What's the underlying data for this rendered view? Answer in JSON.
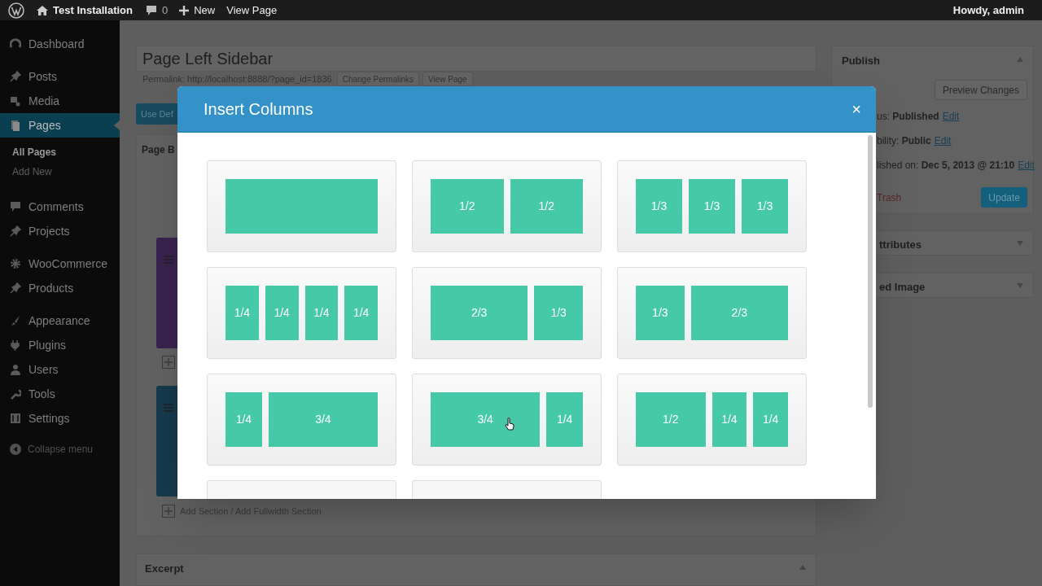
{
  "admin_bar": {
    "site_name": "Test Installation",
    "comments_count": "0",
    "new_label": "New",
    "view_label": "View Page",
    "greeting": "Howdy, admin"
  },
  "sidebar": {
    "groups": [
      {
        "items": [
          {
            "label": "Dashboard",
            "kind": "dashboard",
            "selected": false
          }
        ]
      },
      {
        "items": [
          {
            "label": "Posts",
            "kind": "pin",
            "selected": false
          },
          {
            "label": "Media",
            "kind": "media",
            "selected": false
          },
          {
            "label": "Pages",
            "kind": "pages",
            "selected": true,
            "children": [
              {
                "label": "All Pages",
                "selected": true
              },
              {
                "label": "Add New",
                "selected": false
              }
            ]
          }
        ]
      },
      {
        "items": [
          {
            "label": "Comments",
            "kind": "comment",
            "selected": false
          },
          {
            "label": "Projects",
            "kind": "pin",
            "selected": false
          }
        ]
      },
      {
        "items": [
          {
            "label": "WooCommerce",
            "kind": "gear",
            "selected": false
          },
          {
            "label": "Products",
            "kind": "pin",
            "selected": false
          }
        ]
      },
      {
        "items": [
          {
            "label": "Appearance",
            "kind": "brush",
            "selected": false
          },
          {
            "label": "Plugins",
            "kind": "plug",
            "selected": false
          },
          {
            "label": "Users",
            "kind": "user",
            "selected": false
          },
          {
            "label": "Tools",
            "kind": "wrench",
            "selected": false
          },
          {
            "label": "Settings",
            "kind": "sliders",
            "selected": false
          }
        ]
      }
    ],
    "collapse_label": "Collapse menu"
  },
  "editor": {
    "title": "Page Left Sidebar",
    "permalink": "Permalink: http://localhost:8888/?page_id=1836",
    "permalink_buttons": [
      "Change Permalinks",
      "View Page"
    ],
    "use_default_button": "Use Def",
    "builder_title": "Page B",
    "sections": [
      {
        "color": "#3a2350"
      },
      {
        "color": "#173a4d"
      }
    ],
    "add_section": "Add Section / Add Fullwidth Section",
    "excerpt_title": "Excerpt"
  },
  "publish": {
    "title": "Publish",
    "preview_button": "Preview Changes",
    "rows": [
      {
        "text": "us: **Published**",
        "link": "Edit"
      },
      {
        "text": "bility: **Public**",
        "link": "Edit"
      },
      {
        "text": "lished on: **Dec 5, 2013 @ 21:10**",
        "link": "Edit"
      }
    ],
    "trash_link": "Trash",
    "update_button": "Update"
  },
  "side_boxes": [
    {
      "title": "ttributes"
    },
    {
      "title": "ed Image"
    }
  ],
  "modal": {
    "title": "Insert Columns",
    "close": "×",
    "layouts": [
      {
        "columns": [
          {
            "kind": "full"
          }
        ]
      },
      {
        "columns": [
          {
            "kind": "half",
            "label": "1/2"
          },
          {
            "kind": "half",
            "label": "1/2"
          }
        ]
      },
      {
        "columns": [
          {
            "kind": "third",
            "label": "1/3"
          },
          {
            "kind": "third",
            "label": "1/3"
          },
          {
            "kind": "third",
            "label": "1/3"
          }
        ]
      },
      {
        "columns": [
          {
            "kind": "quarter",
            "label": "1/4"
          },
          {
            "kind": "quarter",
            "label": "1/4"
          },
          {
            "kind": "quarter",
            "label": "1/4"
          },
          {
            "kind": "quarter",
            "label": "1/4"
          }
        ]
      },
      {
        "columns": [
          {
            "kind": "two-thirds",
            "label": "2/3"
          },
          {
            "kind": "third",
            "label": "1/3"
          }
        ]
      },
      {
        "columns": [
          {
            "kind": "third",
            "label": "1/3"
          },
          {
            "kind": "two-thirds",
            "label": "2/3"
          }
        ]
      },
      {
        "columns": [
          {
            "kind": "quarter",
            "label": "1/4"
          },
          {
            "kind": "three-quarters",
            "label": "3/4"
          }
        ]
      },
      {
        "columns": [
          {
            "kind": "three-quarters",
            "label": "3/4"
          },
          {
            "kind": "quarter",
            "label": "1/4"
          }
        ]
      },
      {
        "columns": [
          {
            "kind": "half",
            "label": "1/2"
          },
          {
            "kind": "quarter",
            "label": "1/4"
          },
          {
            "kind": "quarter",
            "label": "1/4"
          }
        ]
      },
      {
        "cut_off": true
      },
      {
        "cut_off": true
      }
    ]
  }
}
